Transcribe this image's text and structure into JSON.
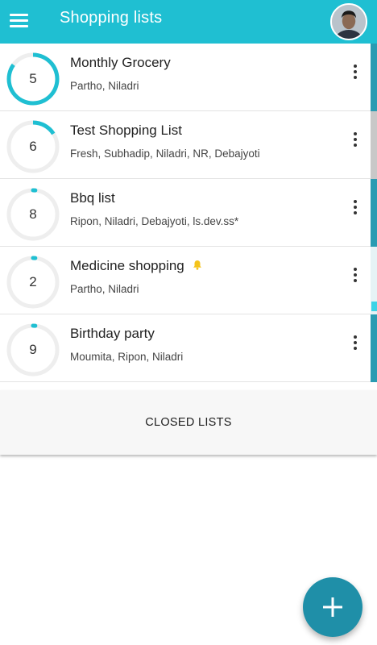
{
  "appbar": {
    "title": "Shopping lists",
    "menu_icon": "hamburger-menu-icon",
    "avatar": "user-avatar"
  },
  "lists": [
    {
      "title": "Monthly Grocery",
      "members": "Partho, Niladri",
      "count": "5",
      "progress": 0.85,
      "has_bell": false,
      "strip_color": "#2a9bb2"
    },
    {
      "title": "Test Shopping List",
      "members": "Fresh, Subhadip, Niladri, NR, Debajyoti",
      "count": "6",
      "progress": 0.16,
      "has_bell": false,
      "strip_color": "#c8c8c8"
    },
    {
      "title": "Bbq list",
      "members": "Ripon, Niladri, Debajyoti, ls.dev.ss*",
      "count": "8",
      "progress": 0.0,
      "has_bell": false,
      "strip_color": "#2a9bb2"
    },
    {
      "title": "Medicine shopping",
      "members": "Partho, Niladri",
      "count": "2",
      "progress": 0.0,
      "has_bell": true,
      "bell_icon": "bell-icon",
      "strip_color": "#e6f3f6"
    },
    {
      "title": "Birthday party",
      "members": "Moumita, Ripon, Niladri",
      "count": "9",
      "progress": 0.0,
      "has_bell": false,
      "strip_color": "#2a9bb2"
    }
  ],
  "closed_lists": {
    "label": "CLOSED LISTS"
  },
  "fab": {
    "icon": "plus-icon"
  },
  "colors": {
    "appbar": "#1fbfd2",
    "progress": "#1fbfd2",
    "track": "#eeeeee",
    "fab": "#1f8fa8",
    "bell": "#f4c31a"
  }
}
